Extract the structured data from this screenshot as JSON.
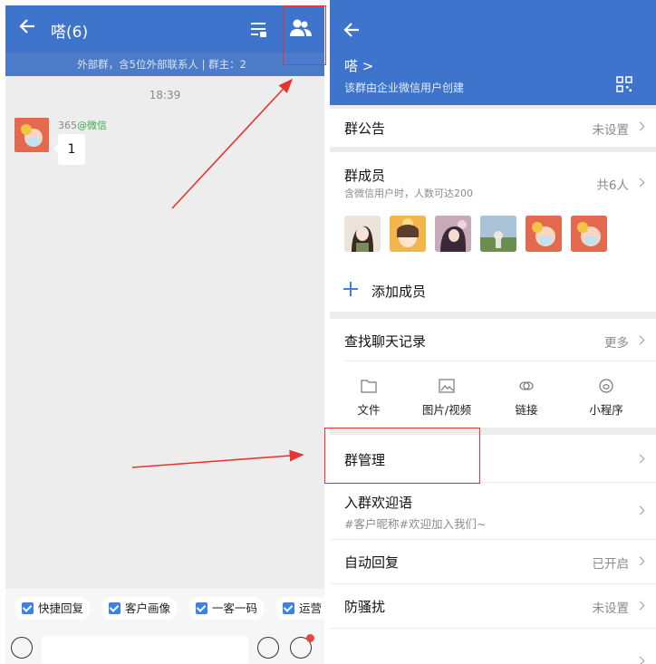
{
  "left_chat": {
    "header": {
      "title": "嗒(6)"
    },
    "subheader": {
      "text": "外部群，含5位外部联系人 | 群主：2"
    },
    "timestamp": "18:39",
    "message": {
      "sender": "365",
      "sender_source": "@微信",
      "text": "1"
    },
    "quick_actions": [
      {
        "label": "快捷回复"
      },
      {
        "label": "客户画像"
      },
      {
        "label": "一客一码"
      },
      {
        "label": "运营"
      }
    ],
    "colors": {
      "header": "#3f74cc",
      "subheader": "#4c7cc8",
      "checkbox": "#3b82e6",
      "sender_source": "#3cac4a"
    }
  },
  "right_detail": {
    "header": {
      "group_name": "嗒 >",
      "description": "该群由企业微信用户创建"
    },
    "announcement": {
      "title": "群公告",
      "value": "未设置"
    },
    "members": {
      "title": "群成员",
      "subtitle": "含微信用户时，人数可达200",
      "count": "共6人",
      "add_label": "添加成员"
    },
    "chat_history": {
      "title": "查找聊天记录",
      "more": "更多",
      "filters": [
        {
          "label": "文件",
          "icon": "folder-icon"
        },
        {
          "label": "图片/视频",
          "icon": "image-icon"
        },
        {
          "label": "链接",
          "icon": "link-icon"
        },
        {
          "label": "小程序",
          "icon": "mini-program-icon"
        }
      ]
    },
    "group_manage": {
      "title": "群管理"
    },
    "welcome": {
      "title": "入群欢迎语",
      "subtitle": "#客户昵称#欢迎加入我们~"
    },
    "auto_reply": {
      "title": "自动回复",
      "value": "已开启"
    },
    "anti_harass": {
      "title": "防骚扰",
      "value": "未设置"
    },
    "colors": {
      "header": "#3f74cc",
      "add_plus": "#3b82e6"
    }
  },
  "annotation": {
    "highlight_color": "#e8332e"
  }
}
